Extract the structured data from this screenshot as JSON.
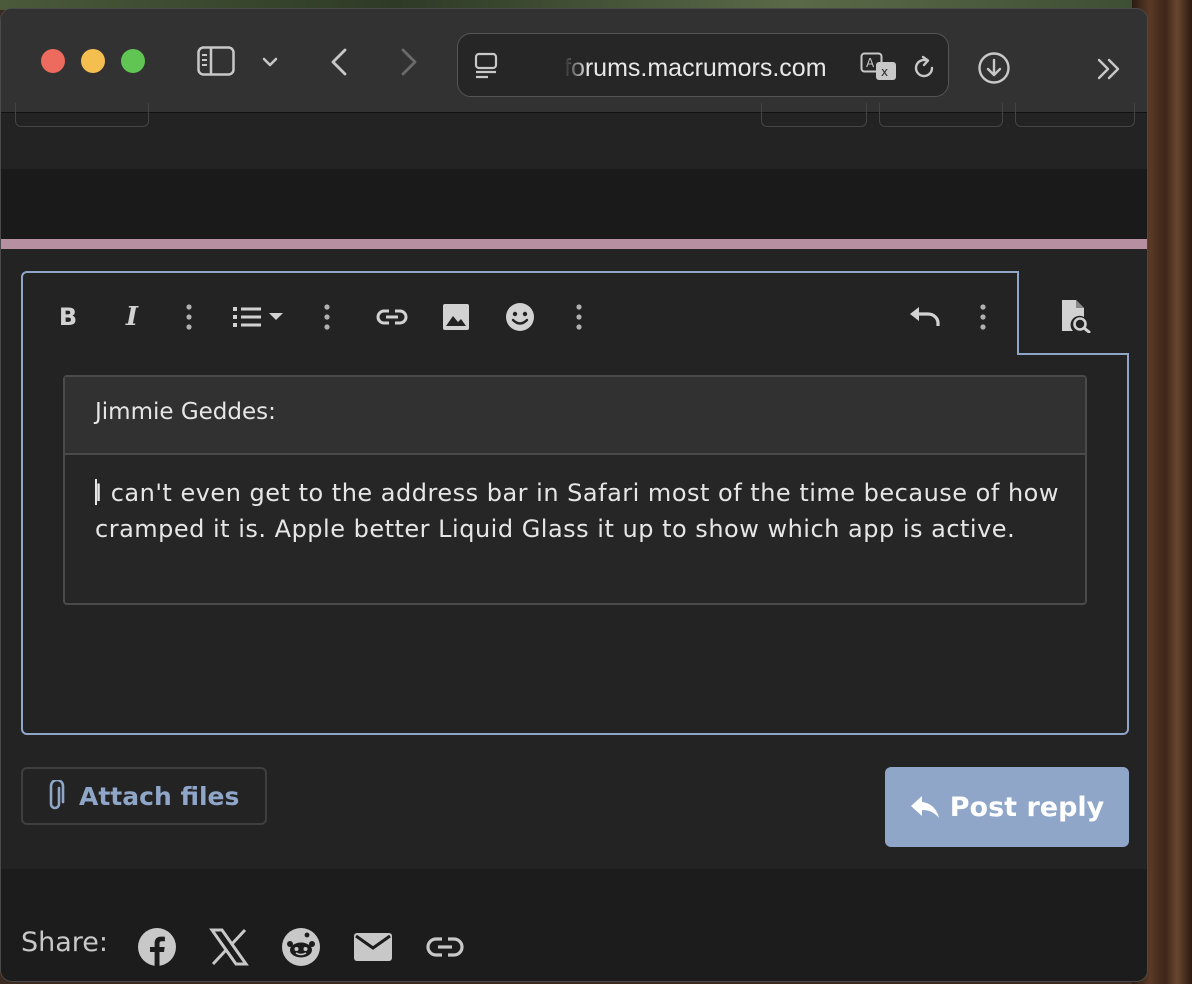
{
  "browser": {
    "url_display": "forums.macrumors.com"
  },
  "editor": {
    "toolbar": {
      "bold": "B",
      "italic": "I"
    },
    "quote": {
      "author": "Jimmie Geddes:",
      "text": "I can't even get to the address bar in Safari most of the time because of how cramped it is. Apple better Liquid Glass it up to show which app is active."
    }
  },
  "actions": {
    "attach_label": "Attach files",
    "post_label": "Post reply"
  },
  "share": {
    "label": "Share:",
    "targets": [
      "facebook-icon",
      "x-icon",
      "reddit-icon",
      "email-icon",
      "link-icon"
    ]
  },
  "colors": {
    "accent": "#8fa6c9",
    "divider": "#b68fa0",
    "background": "#232323"
  }
}
